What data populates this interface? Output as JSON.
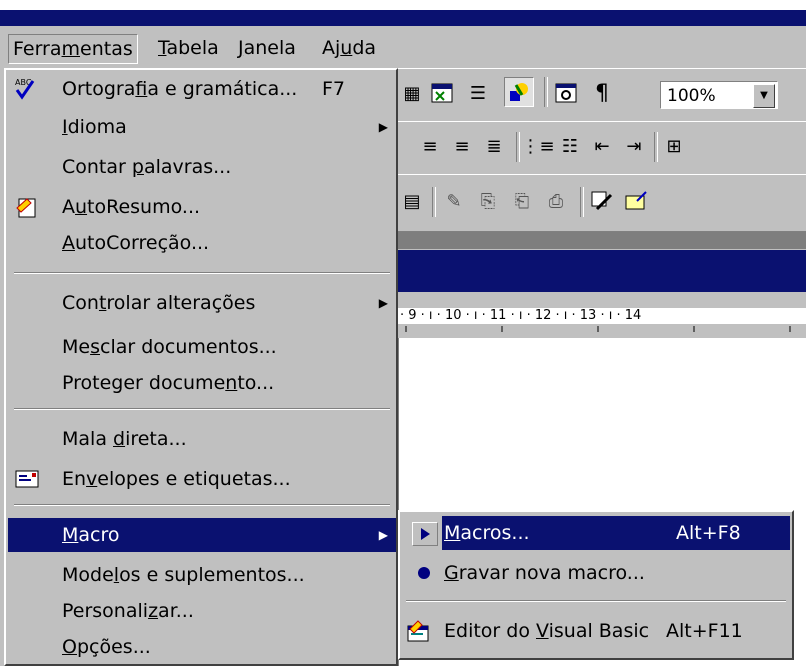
{
  "menubar": {
    "items": [
      {
        "pre": "Ferra",
        "u": "m",
        "post": "entas"
      },
      {
        "pre": "",
        "u": "T",
        "post": "abela"
      },
      {
        "pre": "",
        "u": "J",
        "post": "anela"
      },
      {
        "pre": "Aj",
        "u": "u",
        "post": "da"
      }
    ]
  },
  "toolbar": {
    "zoom": "100%"
  },
  "ruler": {
    "text": "· 9 · ı · 10 · ı · 11 · ı · 12 · ı · 13 · ı · 14"
  },
  "tools_menu": {
    "items": [
      {
        "pre": "Ortogra",
        "u": "f",
        "post": "ia e gramática...",
        "shortcut": "F7"
      },
      {
        "pre": "",
        "u": "I",
        "post": "dioma"
      },
      {
        "pre": "Contar ",
        "u": "p",
        "post": "alavras..."
      },
      {
        "pre": "A",
        "u": "u",
        "post": "toResumo..."
      },
      {
        "pre": "",
        "u": "A",
        "post": "utoCorreção..."
      },
      {
        "pre": "Con",
        "u": "t",
        "post": "rolar alterações"
      },
      {
        "pre": "Me",
        "u": "s",
        "post": "clar documentos..."
      },
      {
        "pre": "Proteger docume",
        "u": "n",
        "post": "to..."
      },
      {
        "pre": "Mala ",
        "u": "d",
        "post": "ireta..."
      },
      {
        "pre": "En",
        "u": "v",
        "post": "elopes e etiquetas..."
      },
      {
        "pre": "",
        "u": "M",
        "post": "acro"
      },
      {
        "pre": "Mode",
        "u": "l",
        "post": "os e suplementos..."
      },
      {
        "pre": "Personali",
        "u": "z",
        "post": "ar..."
      },
      {
        "pre": "",
        "u": "O",
        "post": "pções..."
      }
    ]
  },
  "macro_submenu": {
    "items": [
      {
        "pre": "",
        "u": "M",
        "post": "acros...",
        "shortcut": "Alt+F8"
      },
      {
        "pre": "",
        "u": "G",
        "post": "ravar nova macro..."
      },
      {
        "pre": "Editor do ",
        "u": "V",
        "post": "isual Basic",
        "shortcut": "Alt+F11"
      }
    ]
  },
  "colors": {
    "highlight": "#0a1170",
    "face": "#c0c0c0"
  }
}
